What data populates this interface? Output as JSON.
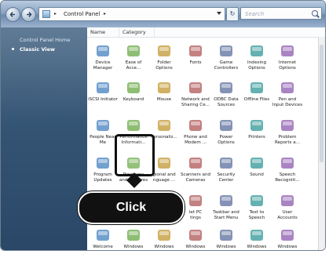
{
  "window": {
    "address": {
      "crumb": "Control Panel",
      "separator": "▸"
    },
    "search": {
      "placeholder": "Search"
    },
    "refresh_glyph": "↻"
  },
  "sidebar": {
    "title": "Control Panel Home",
    "active_item": "Classic View"
  },
  "columns": {
    "name": "Name",
    "category": "Category"
  },
  "items": [
    {
      "label": "Device\nManager",
      "icon": "device-manager-icon"
    },
    {
      "label": "Ease of\nAcce...",
      "icon": "ease-of-access-icon"
    },
    {
      "label": "Folder\nOptions",
      "icon": "folder-options-icon"
    },
    {
      "label": "Fonts",
      "icon": "fonts-icon"
    },
    {
      "label": "Game\nControllers",
      "icon": "game-controllers-icon"
    },
    {
      "label": "Indexing\nOptions",
      "icon": "indexing-options-icon"
    },
    {
      "label": "Internet\nOptions",
      "icon": "internet-options-icon"
    },
    {
      "label": "iSCSI Initiator",
      "icon": "iscsi-icon"
    },
    {
      "label": "Keyboard",
      "icon": "keyboard-icon"
    },
    {
      "label": "Mouse",
      "icon": "mouse-icon"
    },
    {
      "label": "Network and\nSharing Ce...",
      "icon": "network-icon"
    },
    {
      "label": "ODBC Data\nSources",
      "icon": "odbc-icon"
    },
    {
      "label": "Offline Files",
      "icon": "offline-files-icon"
    },
    {
      "label": "Pen and\nInput Devices",
      "icon": "pen-icon"
    },
    {
      "label": "People Near\nMe",
      "icon": "people-near-me-icon"
    },
    {
      "label": "Performance\nInformati...",
      "icon": "performance-icon"
    },
    {
      "label": "Personaliz...",
      "icon": "personalization-icon"
    },
    {
      "label": "Phone and\nModem ...",
      "icon": "phone-modem-icon"
    },
    {
      "label": "Power\nOptions",
      "icon": "power-options-icon"
    },
    {
      "label": "Printers",
      "icon": "printers-icon"
    },
    {
      "label": "Problem\nReports a...",
      "icon": "problem-reports-icon"
    },
    {
      "label": "Program\nUpdates",
      "icon": "program-updates-icon"
    },
    {
      "label": "Programs\nand Features",
      "icon": "programs-features-icon"
    },
    {
      "label": "gional and\nnguage ...",
      "icon": "regional-language-icon"
    },
    {
      "label": "Scanners and\nCameras",
      "icon": "scanners-icon"
    },
    {
      "label": "Security\nCenter",
      "icon": "security-center-icon"
    },
    {
      "label": "Sound",
      "icon": "sound-icon"
    },
    {
      "label": "Speech\nRecogniti...",
      "icon": "speech-icon"
    },
    {
      "label": "",
      "icon": "sync-center-icon"
    },
    {
      "label": "",
      "icon": "system-icon"
    },
    {
      "label": "",
      "icon": "tablet-icon"
    },
    {
      "label": "let PC\ntings",
      "icon": "tablet-pc-icon"
    },
    {
      "label": "Taskbar and\nStart Menu",
      "icon": "taskbar-icon"
    },
    {
      "label": "Text to\nSpeech",
      "icon": "text-to-speech-icon"
    },
    {
      "label": "User\nAccounts",
      "icon": "user-accounts-icon"
    },
    {
      "label": "Welcome\nCenter",
      "icon": "welcome-center-icon"
    },
    {
      "label": "Windows\nAnytim...",
      "icon": "windows-anytime-icon"
    },
    {
      "label": "Windows\nCardSpace",
      "icon": "cardspace-icon"
    },
    {
      "label": "Windows\nDefender",
      "icon": "defender-icon"
    },
    {
      "label": "Windows\nFirewall",
      "icon": "firewall-icon"
    },
    {
      "label": "Windows\nMobilit...",
      "icon": "mobility-icon"
    },
    {
      "label": "Windows\nSidebar ...",
      "icon": "sidebar-icon"
    }
  ],
  "callout": {
    "text": "Click"
  }
}
